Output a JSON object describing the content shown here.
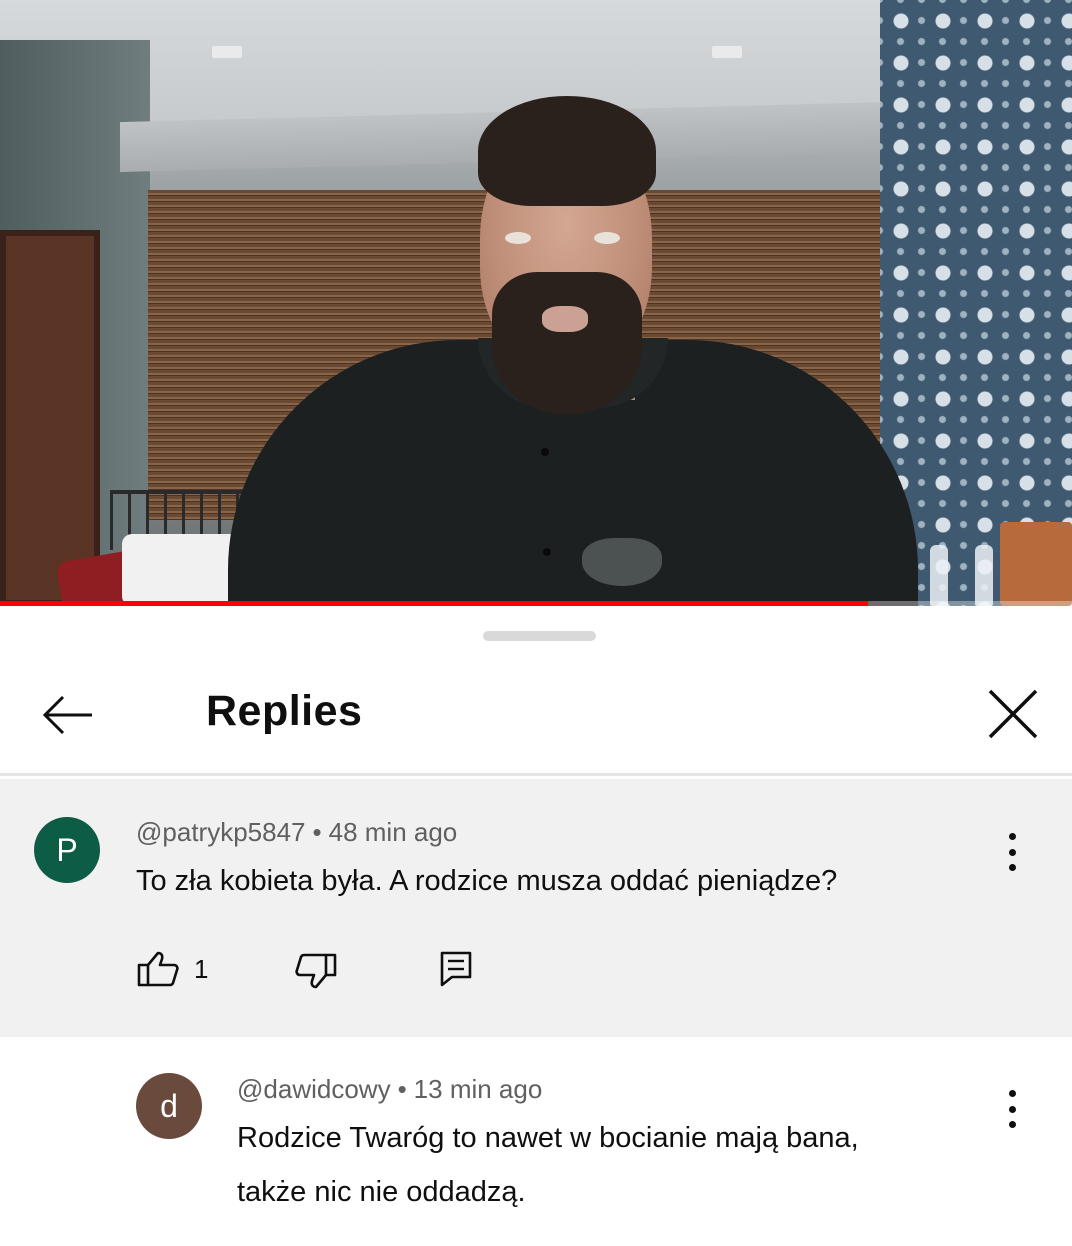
{
  "video": {
    "progress_fraction": 0.81,
    "accent_color": "#ff0000"
  },
  "panel": {
    "title": "Replies",
    "back_icon": "arrow-left-icon",
    "close_icon": "close-icon"
  },
  "parent_comment": {
    "avatar_letter": "P",
    "avatar_color": "#0d5c46",
    "author": "@patrykp5847",
    "separator": "•",
    "time": "48 min ago",
    "text": "To zła kobieta była. A rodzice musza oddać pieniądze?",
    "like_count": "1",
    "like_icon": "thumb-up-icon",
    "dislike_icon": "thumb-down-icon",
    "reply_icon": "comment-icon",
    "menu_icon": "more-vertical-icon"
  },
  "replies": [
    {
      "avatar_letter": "d",
      "avatar_color": "#6b4a3e",
      "author": "@dawidcowy",
      "separator": "•",
      "time": "13 min ago",
      "text_line1": "Rodzice Twaróg to nawet w bocianie mają bana,",
      "text_line2": "także nic nie oddadzą.",
      "menu_icon": "more-vertical-icon"
    }
  ]
}
